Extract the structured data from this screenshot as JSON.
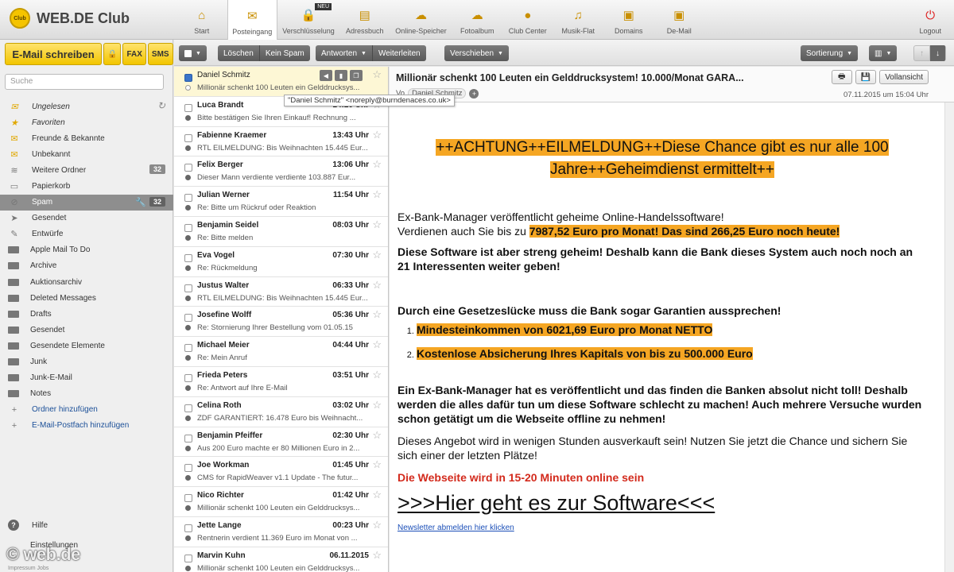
{
  "app": {
    "brand": "WEB.DE Club",
    "badge": "Club"
  },
  "topnav": [
    {
      "label": "Start",
      "icon": "home-icon"
    },
    {
      "label": "Posteingang",
      "icon": "envelope-icon"
    },
    {
      "label": "Verschlüsselung",
      "icon": "lock-icon",
      "badge": "NEU"
    },
    {
      "label": "Adressbuch",
      "icon": "addressbook-icon"
    },
    {
      "label": "Online-Speicher",
      "icon": "cloud-icon"
    },
    {
      "label": "Fotoalbum",
      "icon": "camera-cloud-icon"
    },
    {
      "label": "Club Center",
      "icon": "club-icon"
    },
    {
      "label": "Musik-Flat",
      "icon": "music-icon"
    },
    {
      "label": "Domains",
      "icon": "domain-icon"
    },
    {
      "label": "De-Mail",
      "icon": "demail-icon"
    }
  ],
  "logout": "Logout",
  "sidebar": {
    "write_label": "E-Mail schreiben",
    "fax_label": "FAX",
    "sms_label": "SMS",
    "search_placeholder": "Suche",
    "folders": [
      {
        "label": "Ungelesen",
        "icon": "envelope-icon"
      },
      {
        "label": "Favoriten",
        "icon": "star-icon"
      },
      {
        "label": "Freunde & Bekannte",
        "icon": "envelope-icon"
      },
      {
        "label": "Unbekannt",
        "icon": "envelope-icon"
      },
      {
        "label": "Weitere Ordner",
        "icon": "folders-icon",
        "count": "32"
      },
      {
        "label": "Papierkorb",
        "icon": "trash-icon"
      },
      {
        "label": "Spam",
        "icon": "spam-icon",
        "count": "32"
      },
      {
        "label": "Gesendet",
        "icon": "send-icon"
      },
      {
        "label": "Entwürfe",
        "icon": "pencil-icon"
      },
      {
        "label": "Apple Mail To Do",
        "icon": "folder-icon"
      },
      {
        "label": "Archive",
        "icon": "folder-icon"
      },
      {
        "label": "Auktionsarchiv",
        "icon": "folder-icon"
      },
      {
        "label": "Deleted Messages",
        "icon": "folder-icon"
      },
      {
        "label": "Drafts",
        "icon": "folder-icon"
      },
      {
        "label": "Gesendet",
        "icon": "folder-icon"
      },
      {
        "label": "Gesendete Elemente",
        "icon": "folder-icon"
      },
      {
        "label": "Junk",
        "icon": "folder-icon"
      },
      {
        "label": "Junk-E-Mail",
        "icon": "folder-icon"
      },
      {
        "label": "Notes",
        "icon": "folder-icon"
      },
      {
        "label": "Ordner hinzufügen",
        "icon": "plus-icon"
      },
      {
        "label": "E-Mail-Postfach hinzufügen",
        "icon": "plus-icon"
      }
    ],
    "help": "Hilfe",
    "settings": "Einstellungen",
    "watermark": "© web.de",
    "footer": "Impressum   Jobs"
  },
  "toolbar": {
    "delete": "Löschen",
    "not_spam": "Kein Spam",
    "reply": "Antworten",
    "forward": "Weiterleiten",
    "move": "Verschieben",
    "sort": "Sortierung"
  },
  "messages": [
    {
      "from": "Daniel Schmitz",
      "time": "",
      "subject": "Millionär schenkt 100 Leuten ein Gelddrucksys..."
    },
    {
      "from": "Luca Brandt",
      "time": "14:20 Uhr",
      "subject": "Bitte bestätigen Sie Ihren Einkauf! Rechnung ..."
    },
    {
      "from": "Fabienne Kraemer",
      "time": "13:43 Uhr",
      "subject": "RTL EILMELDUNG: Bis Weihnachten 15.445 Eur..."
    },
    {
      "from": "Felix Berger",
      "time": "13:06 Uhr",
      "subject": "Dieser Mann verdiente verdiente 103.887 Eur..."
    },
    {
      "from": "Julian Werner",
      "time": "11:54 Uhr",
      "subject": "Re: Bitte um Rückruf oder Reaktion"
    },
    {
      "from": "Benjamin Seidel",
      "time": "08:03 Uhr",
      "subject": "Re: Bitte melden"
    },
    {
      "from": "Eva Vogel",
      "time": "07:30 Uhr",
      "subject": "Re: Rückmeldung"
    },
    {
      "from": "Justus Walter",
      "time": "06:33 Uhr",
      "subject": "RTL EILMELDUNG: Bis Weihnachten 15.445 Eur..."
    },
    {
      "from": "Josefine Wolff",
      "time": "05:36 Uhr",
      "subject": "Re: Stornierung Ihrer Bestellung vom 01.05.15"
    },
    {
      "from": "Michael Meier",
      "time": "04:44 Uhr",
      "subject": "Re: Mein Anruf"
    },
    {
      "from": "Frieda Peters",
      "time": "03:51 Uhr",
      "subject": "Re: Antwort auf Ihre E-Mail"
    },
    {
      "from": "Celina Roth",
      "time": "03:02 Uhr",
      "subject": "ZDF GARANTIERT: 16.478 Euro bis Weihnacht..."
    },
    {
      "from": "Benjamin Pfeiffer",
      "time": "02:30 Uhr",
      "subject": "Aus 200 Euro machte er 80 Millionen Euro in 2..."
    },
    {
      "from": "Joe Workman",
      "time": "01:45 Uhr",
      "subject": "CMS for RapidWeaver v1.1 Update - The futur..."
    },
    {
      "from": "Nico Richter",
      "time": "01:42 Uhr",
      "subject": "Millionär schenkt 100 Leuten ein Gelddrucksys..."
    },
    {
      "from": "Jette Lange",
      "time": "00:23 Uhr",
      "subject": "Rentnerin verdient 11.369 Euro im Monat von ..."
    },
    {
      "from": "Marvin Kuhn",
      "time": "06.11.2015",
      "subject": "Millionär schenkt 100 Leuten ein Gelddrucksys..."
    }
  ],
  "tooltip": "\"Daniel Schmitz\" <noreply@burndenaces.co.uk>",
  "reading": {
    "subject": "Millionär schenkt 100 Leuten ein Gelddrucksystem! 10.000/Monat GARA...",
    "sender_prefix": "Vo",
    "sender": "Daniel Schmitz",
    "date": "07.11.2015 um 15:04 Uhr",
    "full_view": "Vollansicht",
    "headline": "++ACHTUNG++EILMELDUNG++Diese Chance gibt es nur alle 100 Jahre++Geheimdienst ermittelt++",
    "p1_line1": "Ex-Bank-Manager veröffentlicht geheime Online-Handelssoftware!",
    "p1_line2": "Verdienen auch Sie bis zu ",
    "p1_highlight": "7987,52 Euro pro Monat! Das sind 266,25 Euro noch heute!",
    "p2": "Diese Software ist aber streng geheim! Deshalb kann die Bank dieses System auch noch noch an 21 Interessenten weiter geben!",
    "p3": "Durch eine Gesetzeslücke muss die Bank sogar Garantien aussprechen!",
    "list": [
      "Mindesteinkommen von 6021,69 Euro pro Monat NETTO",
      "Kostenlose Absicherung Ihres Kapitals von bis zu 500.000 Euro"
    ],
    "p4": "Ein Ex-Bank-Manager hat es veröffentlicht und das finden die Banken absolut nicht toll! Deshalb werden die alles dafür tun um diese Software schlecht zu machen! Auch mehrere Versuche wurden schon getätigt um die Webseite offline zu nehmen!",
    "p5": "Dieses Angebot wird in wenigen Stunden ausverkauft sein! Nutzen Sie jetzt die Chance und sichern Sie sich einer der letzten Plätze!",
    "red_line": "Die Webseite wird in 15-20 Minuten online sein",
    "big_link": ">>>Hier geht es zur Software<<<",
    "unsubscribe": "Newsletter abmelden hier klicken"
  }
}
